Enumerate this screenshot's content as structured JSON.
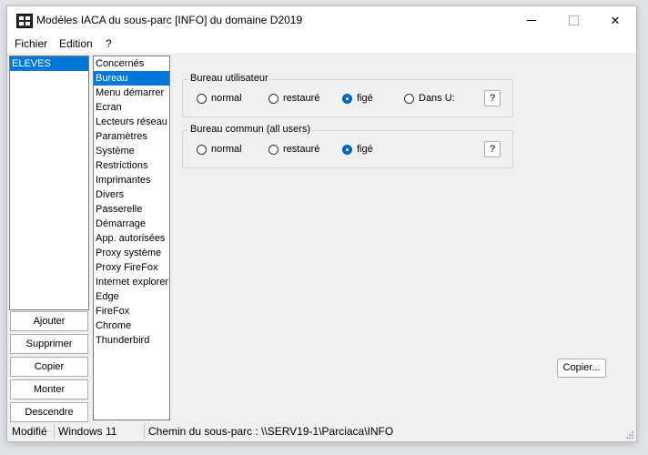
{
  "window": {
    "title": "Modèles IACA du sous-parc [INFO] du domaine D2019",
    "minimize": "minimize",
    "maximize": "maximize",
    "close": "✕"
  },
  "menu": [
    "Fichier",
    "Edition",
    "?"
  ],
  "groups": {
    "items": [
      "ELEVES"
    ],
    "selected": 0
  },
  "categories": {
    "items": [
      "Concernés",
      "Bureau",
      "Menu démarrer",
      "Ecran",
      "Lecteurs réseau",
      "Paramètres",
      "Système",
      "Restrictions",
      "Imprimantes",
      "Divers",
      "Passerelle",
      "Démarrage",
      "App. autorisées",
      "Proxy système",
      "Proxy FireFox",
      "Internet explorer",
      "Edge",
      "FireFox",
      "Chrome",
      "Thunderbird"
    ],
    "selected": 1
  },
  "buttons": {
    "ajouter": "Ajouter",
    "supprimer": "Supprimer",
    "copier": "Copier",
    "monter": "Monter",
    "descendre": "Descendre",
    "copier_dots": "Copier..."
  },
  "bureau_utilisateur": {
    "title": "Bureau utilisateur",
    "options": [
      "normal",
      "restauré",
      "figé",
      "Dans U:"
    ],
    "selected": 2,
    "help": "?"
  },
  "bureau_commun": {
    "title": "Bureau commun (all users)",
    "options": [
      "normal",
      "restauré",
      "figé"
    ],
    "selected": 2,
    "help": "?"
  },
  "status": {
    "state": "Modifié",
    "os": "Windows 11",
    "path": "Chemin du sous-parc : \\\\SERV19-1\\Parciaca\\INFO"
  },
  "colors": {
    "selection": "#0078d7",
    "radio_on": "#0067c0"
  }
}
